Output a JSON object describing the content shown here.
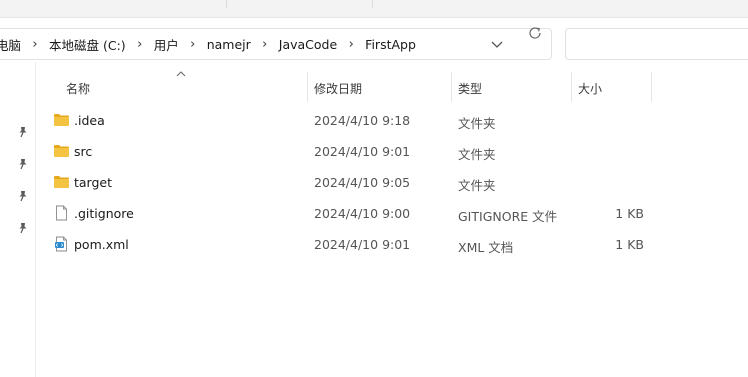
{
  "breadcrumb": {
    "items": [
      "电脑",
      "本地磁盘 (C:)",
      "用户",
      "namejr",
      "JavaCode",
      "FirstApp"
    ],
    "separator": "›"
  },
  "columns": {
    "name": "名称",
    "modified": "修改日期",
    "type": "类型",
    "size": "大小"
  },
  "files": [
    {
      "name": ".idea",
      "modified": "2024/4/10 9:18",
      "type": "文件夹",
      "size": "",
      "icon": "folder-icon"
    },
    {
      "name": "src",
      "modified": "2024/4/10 9:01",
      "type": "文件夹",
      "size": "",
      "icon": "folder-icon"
    },
    {
      "name": "target",
      "modified": "2024/4/10 9:05",
      "type": "文件夹",
      "size": "",
      "icon": "folder-icon"
    },
    {
      "name": ".gitignore",
      "modified": "2024/4/10 9:00",
      "type": "GITIGNORE 文件",
      "size": "1 KB",
      "icon": "blank-file-icon"
    },
    {
      "name": "pom.xml",
      "modified": "2024/4/10 9:01",
      "type": "XML 文档",
      "size": "1 KB",
      "icon": "xml-file-icon"
    }
  ],
  "colors": {
    "folder": "#f5c342",
    "folder_dark": "#e6a91e",
    "border": "#e1e1e1"
  }
}
